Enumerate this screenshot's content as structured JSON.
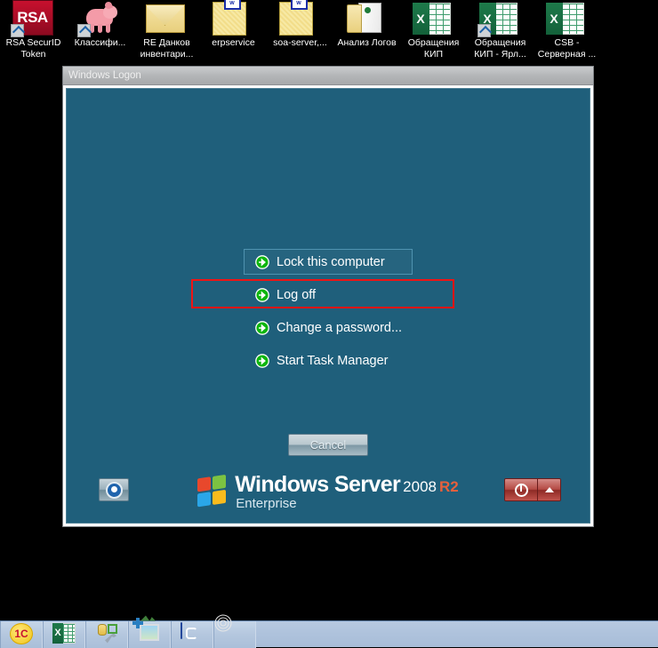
{
  "desktop": {
    "icons": [
      {
        "label": "RSA SecurID Token",
        "icon": "rsa-securid-icon",
        "shortcut": true
      },
      {
        "label": "Классифи...",
        "icon": "pig-icon",
        "shortcut": true
      },
      {
        "label": "RE Данков инвентари...",
        "icon": "envelope-icon",
        "shortcut": false
      },
      {
        "label": "erpservice",
        "icon": "yellow-file-icon",
        "shortcut": false
      },
      {
        "label": "soa-server,...",
        "icon": "yellow-file-icon",
        "shortcut": false
      },
      {
        "label": "Анализ Логов",
        "icon": "folder-icon",
        "shortcut": false
      },
      {
        "label": "Обращения КИП",
        "icon": "excel-icon",
        "shortcut": false
      },
      {
        "label": "Обращения КИП - Ярл...",
        "icon": "excel-icon",
        "shortcut": true
      },
      {
        "label": "CSB - Серверная ...",
        "icon": "excel-icon",
        "shortcut": false
      }
    ]
  },
  "dialog": {
    "title": "Windows Logon",
    "options": [
      {
        "label": "Lock this computer",
        "icon": "green-arrow-icon",
        "focused": true
      },
      {
        "label": "Log off",
        "icon": "green-arrow-icon",
        "focused": false
      },
      {
        "label": "Change a password...",
        "icon": "green-arrow-icon",
        "focused": false
      },
      {
        "label": "Start Task Manager",
        "icon": "green-arrow-icon",
        "focused": false,
        "highlighted": true
      }
    ],
    "cancel_label": "Cancel",
    "branding": {
      "product": "Windows Server",
      "version": "2008",
      "release": "R2",
      "edition": "Enterprise"
    },
    "ease_of_access_icon": "ease-of-access-icon",
    "power_icon": "power-icon",
    "power_more_icon": "caret-up-icon",
    "highlight_color": "#ef1414",
    "background_color": "#1f5f7b"
  },
  "taskbar": {
    "items": [
      {
        "icon": "1c-app-icon",
        "label": "1C"
      },
      {
        "icon": "excel-icon",
        "label": "X"
      },
      {
        "icon": "database-tool-icon",
        "label": ""
      },
      {
        "icon": "image-viewer-icon",
        "label": ""
      },
      {
        "icon": "blue-loop-app-icon",
        "label": ""
      },
      {
        "icon": "audio-wireless-icon",
        "label": ""
      }
    ]
  }
}
